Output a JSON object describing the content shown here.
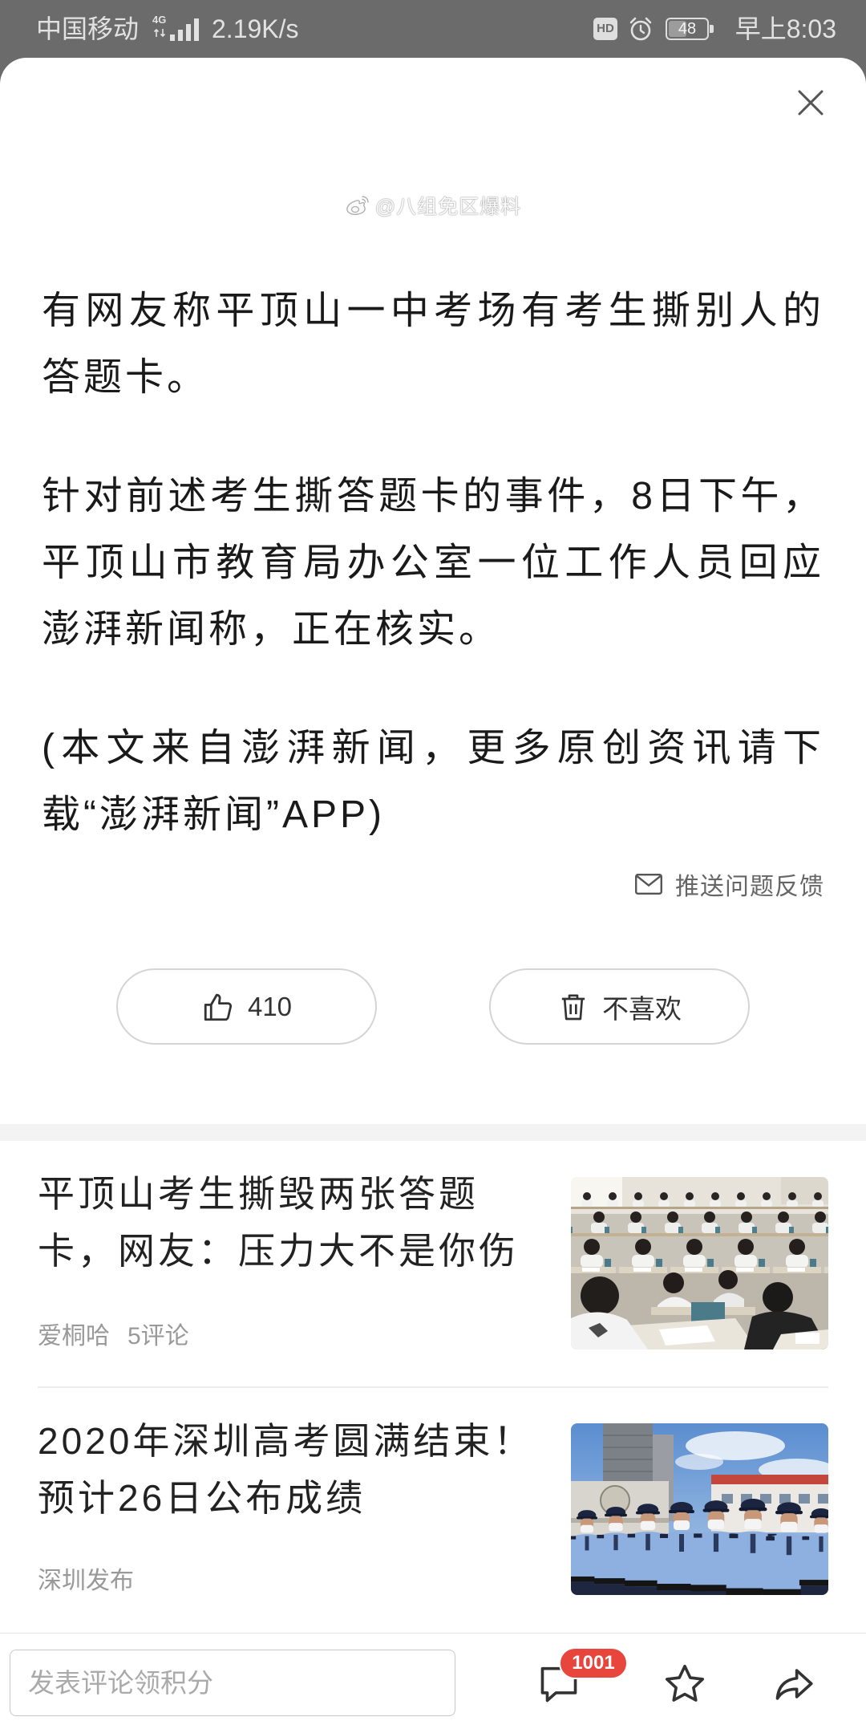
{
  "status_bar": {
    "carrier": "中国移动",
    "network_type": "4G",
    "network_speed": "2.19K/s",
    "hd_label": "HD",
    "battery_level": "48",
    "time": "早上8:03",
    "icons": [
      "signal-icon",
      "hd-icon",
      "alarm-icon",
      "battery-icon"
    ]
  },
  "article": {
    "close_icon": "close-icon",
    "watermark": {
      "icon": "weibo-logo-icon",
      "text": "@八组免区爆料"
    },
    "paragraphs": [
      "有网友称平顶山一中考场有考生撕别人的答题卡。",
      "针对前述考生撕答题卡的事件，8日下午，平顶山市教育局办公室一位工作人员回应澎湃新闻称，正在核实。",
      "(本文来自澎湃新闻，更多原创资讯请下载“澎湃新闻”APP)"
    ],
    "feedback": {
      "icon": "mail-icon",
      "label": "推送问题反馈"
    },
    "like": {
      "icon": "thumbs-up-icon",
      "count": "410"
    },
    "dislike": {
      "icon": "trash-icon",
      "label": "不喜欢"
    }
  },
  "related": [
    {
      "title": "平顶山考生撕毁两张答题卡，网友：压力大不是你伤",
      "source": "爱桐哈",
      "comments": "5评论"
    },
    {
      "title": "2020年深圳高考圆满结束！预计26日公布成绩",
      "source": "深圳发布"
    }
  ],
  "bottom_bar": {
    "comment_input_placeholder": "发表评论领积分",
    "comment_count_badge": "1001",
    "icons": [
      "comment-icon",
      "star-icon",
      "share-icon"
    ]
  },
  "colors": {
    "backdrop": "#6b6b6b",
    "badge_red": "#e8453c",
    "body_text": "#1a1a1a",
    "meta_text": "#999999"
  }
}
